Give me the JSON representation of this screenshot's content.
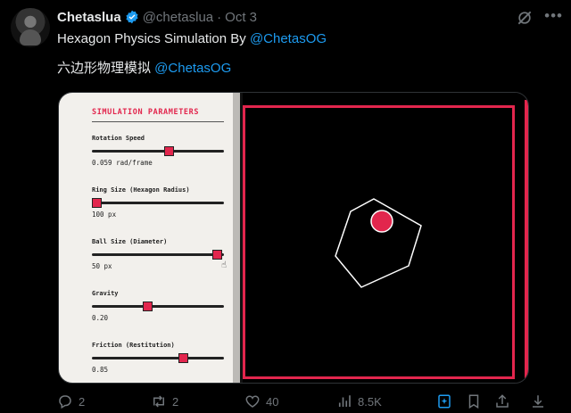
{
  "tweet": {
    "display_name": "Chetaslua",
    "handle": "@chetaslua",
    "separator": "·",
    "date": "Oct 3",
    "line1_text": "Hexagon Physics Simulation By ",
    "line1_mention": "@ChetasOG",
    "line2_text": "六边形物理模拟 ",
    "line2_mention": "@ChetasOG"
  },
  "simulation": {
    "title": "SIMULATION PARAMETERS",
    "params": [
      {
        "label": "Rotation Speed",
        "value": "0.059 rad/frame",
        "level": 0.58
      },
      {
        "label": "Ring Size (Hexagon Radius)",
        "value": "100 px",
        "level": 0.0
      },
      {
        "label": "Ball Size (Diameter)",
        "value": "50 px",
        "level": 0.97
      },
      {
        "label": "Gravity",
        "value": "0.20",
        "level": 0.41
      },
      {
        "label": "Friction (Restitution)",
        "value": "0.85",
        "level": 0.7
      }
    ]
  },
  "actions": {
    "reply_count": "2",
    "retweet_count": "2",
    "like_count": "40",
    "view_count": "8.5K"
  },
  "colors": {
    "accent": "#e2264d",
    "link": "#1d9bf0",
    "verified": "#1d9bf0"
  }
}
